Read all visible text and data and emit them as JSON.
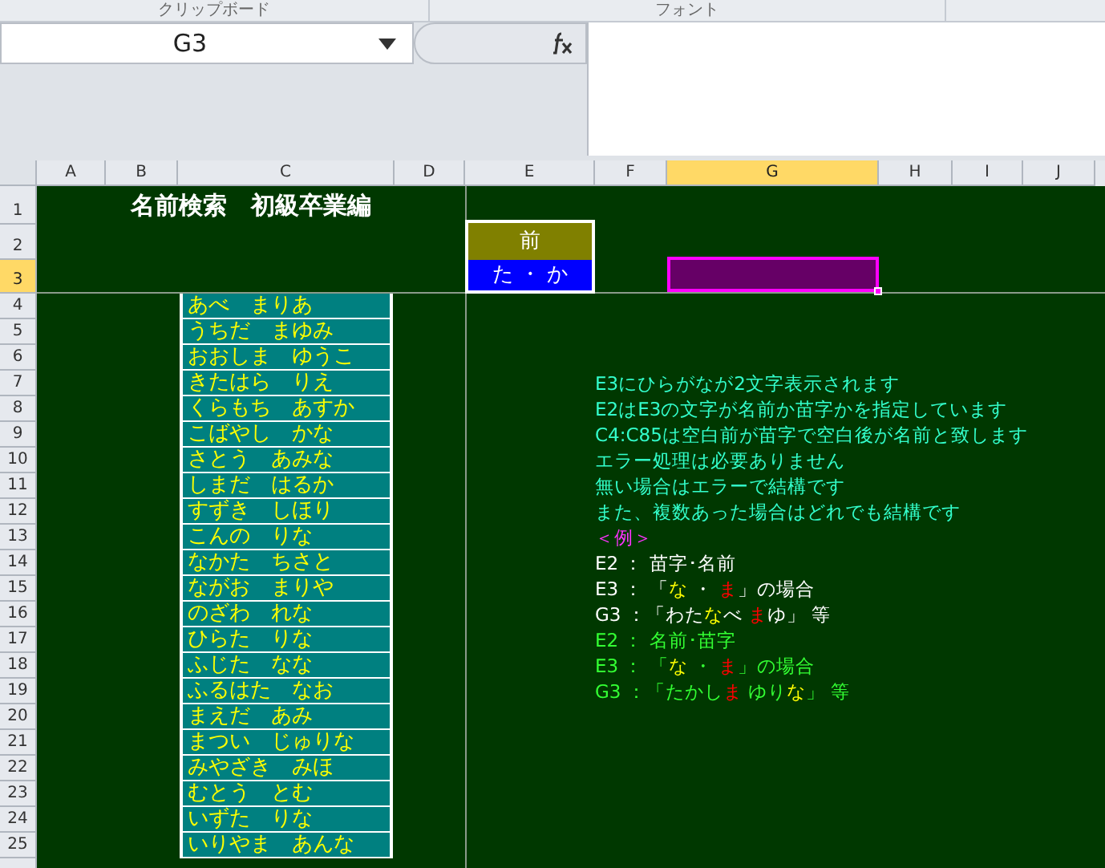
{
  "ribbon_groups": [
    "クリップボード",
    "フォント"
  ],
  "name_box": "G3",
  "column_headers": [
    {
      "label": "A",
      "selected": false
    },
    {
      "label": "B",
      "selected": false
    },
    {
      "label": "C",
      "selected": false
    },
    {
      "label": "D",
      "selected": false
    },
    {
      "label": "E",
      "selected": false
    },
    {
      "label": "F",
      "selected": false
    },
    {
      "label": "G",
      "selected": true
    },
    {
      "label": "H",
      "selected": false
    },
    {
      "label": "I",
      "selected": false
    },
    {
      "label": "J",
      "selected": false
    }
  ],
  "row_headers": [
    {
      "label": "1",
      "selected": false
    },
    {
      "label": "2",
      "selected": false
    },
    {
      "label": "3",
      "selected": true
    },
    {
      "label": "4",
      "selected": false
    },
    {
      "label": "5",
      "selected": false
    },
    {
      "label": "6",
      "selected": false
    },
    {
      "label": "7",
      "selected": false
    },
    {
      "label": "8",
      "selected": false
    },
    {
      "label": "9",
      "selected": false
    },
    {
      "label": "10",
      "selected": false
    },
    {
      "label": "11",
      "selected": false
    },
    {
      "label": "12",
      "selected": false
    },
    {
      "label": "13",
      "selected": false
    },
    {
      "label": "14",
      "selected": false
    },
    {
      "label": "15",
      "selected": false
    },
    {
      "label": "16",
      "selected": false
    },
    {
      "label": "17",
      "selected": false
    },
    {
      "label": "18",
      "selected": false
    },
    {
      "label": "19",
      "selected": false
    },
    {
      "label": "20",
      "selected": false
    },
    {
      "label": "21",
      "selected": false
    },
    {
      "label": "22",
      "selected": false
    },
    {
      "label": "23",
      "selected": false
    },
    {
      "label": "24",
      "selected": false
    },
    {
      "label": "25",
      "selected": false
    }
  ],
  "title": "名前検索　初級卒業編",
  "e2": "前",
  "e3": "た ・ か",
  "names": [
    "あべ　まりあ",
    "うちだ　まゆみ",
    "おおしま　ゆうこ",
    "きたはら　りえ",
    "くらもち　あすか",
    "こばやし　かな",
    "さとう　あみな",
    "しまだ　はるか",
    "すずき　しほり",
    "こんの　りな",
    "なかた　ちさと",
    "ながお　まりや",
    "のざわ　れな",
    "ひらた　りな",
    "ふじた　なな",
    "ふるはた　なお",
    "まえだ　あみ",
    "まつい　じゅりな",
    "みやざき　みほ",
    "むとう　とむ",
    "いずた　りな",
    "いりやま　あんな"
  ],
  "notes": [
    {
      "segments": [
        {
          "text": "E3にひらがなが2文字表示されます",
          "color": "#33ffcc"
        }
      ]
    },
    {
      "segments": [
        {
          "text": "E2はE3の文字が名前か苗字かを指定しています",
          "color": "#33ffcc"
        }
      ]
    },
    {
      "segments": [
        {
          "text": "C4:C85は空白前が苗字で空白後が名前と致します",
          "color": "#33ffcc"
        }
      ]
    },
    {
      "segments": [
        {
          "text": "エラー処理は必要ありません",
          "color": "#33ffcc"
        }
      ]
    },
    {
      "segments": [
        {
          "text": "無い場合はエラーで結構です",
          "color": "#33ffcc"
        }
      ]
    },
    {
      "segments": [
        {
          "text": "また、複数あった場合はどれでも結構です",
          "color": "#33ffcc"
        }
      ]
    },
    {
      "segments": [
        {
          "text": "＜例＞",
          "color": "#ff33ff"
        }
      ]
    },
    {
      "segments": [
        {
          "text": "E2 ： 苗字･名前",
          "color": "#ffffff"
        }
      ]
    },
    {
      "segments": [
        {
          "text": "E3 ： 「",
          "color": "#ffffff"
        },
        {
          "text": "な",
          "color": "#ffff00"
        },
        {
          "text": " ・ ",
          "color": "#ffffff"
        },
        {
          "text": "ま",
          "color": "#ff0000"
        },
        {
          "text": "」の場合",
          "color": "#ffffff"
        }
      ]
    },
    {
      "segments": [
        {
          "text": "G3 ：「わた",
          "color": "#ffffff"
        },
        {
          "text": "な",
          "color": "#ffff00"
        },
        {
          "text": "べ ",
          "color": "#ffffff"
        },
        {
          "text": "ま",
          "color": "#ff0000"
        },
        {
          "text": "ゆ」 等",
          "color": "#ffffff"
        }
      ]
    },
    {
      "segments": [
        {
          "text": "E2 ： 名前･苗字",
          "color": "#33ff33"
        }
      ]
    },
    {
      "segments": [
        {
          "text": "E3 ： 「",
          "color": "#33ff33"
        },
        {
          "text": "な",
          "color": "#ffff00"
        },
        {
          "text": " ・ ",
          "color": "#33ff33"
        },
        {
          "text": "ま",
          "color": "#ff0000"
        },
        {
          "text": "」の場合",
          "color": "#33ff33"
        }
      ]
    },
    {
      "segments": [
        {
          "text": "G3 ：「たかし",
          "color": "#33ff33"
        },
        {
          "text": "ま",
          "color": "#ff0000"
        },
        {
          "text": " ゆり",
          "color": "#33ff33"
        },
        {
          "text": "な",
          "color": "#ffff00"
        },
        {
          "text": "」 等",
          "color": "#33ff33"
        }
      ]
    }
  ]
}
